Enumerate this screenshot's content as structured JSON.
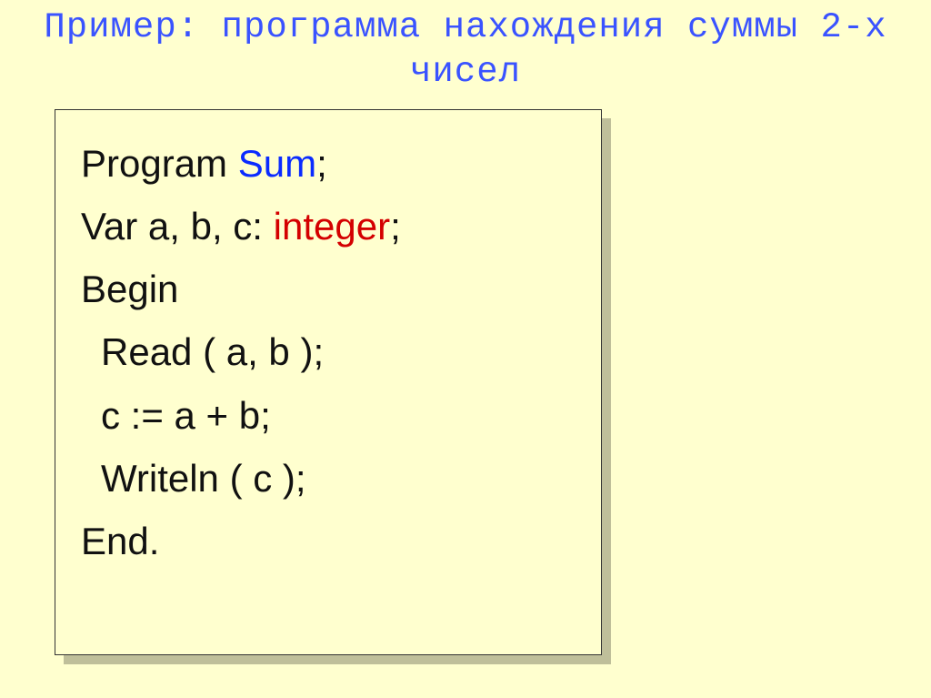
{
  "title": "Пример: программа нахождения суммы 2-х чисел",
  "code": {
    "l1a": "Program ",
    "l1b": "Sum",
    "l1c": ";",
    "l2a": "Var a, b, c: ",
    "l2b": "integer",
    "l2c": ";",
    "l3": "Begin",
    "l4": "Read ( a, b );",
    "l5": "c := a + b;",
    "l6": "Writeln ( c );",
    "l7": "End."
  }
}
